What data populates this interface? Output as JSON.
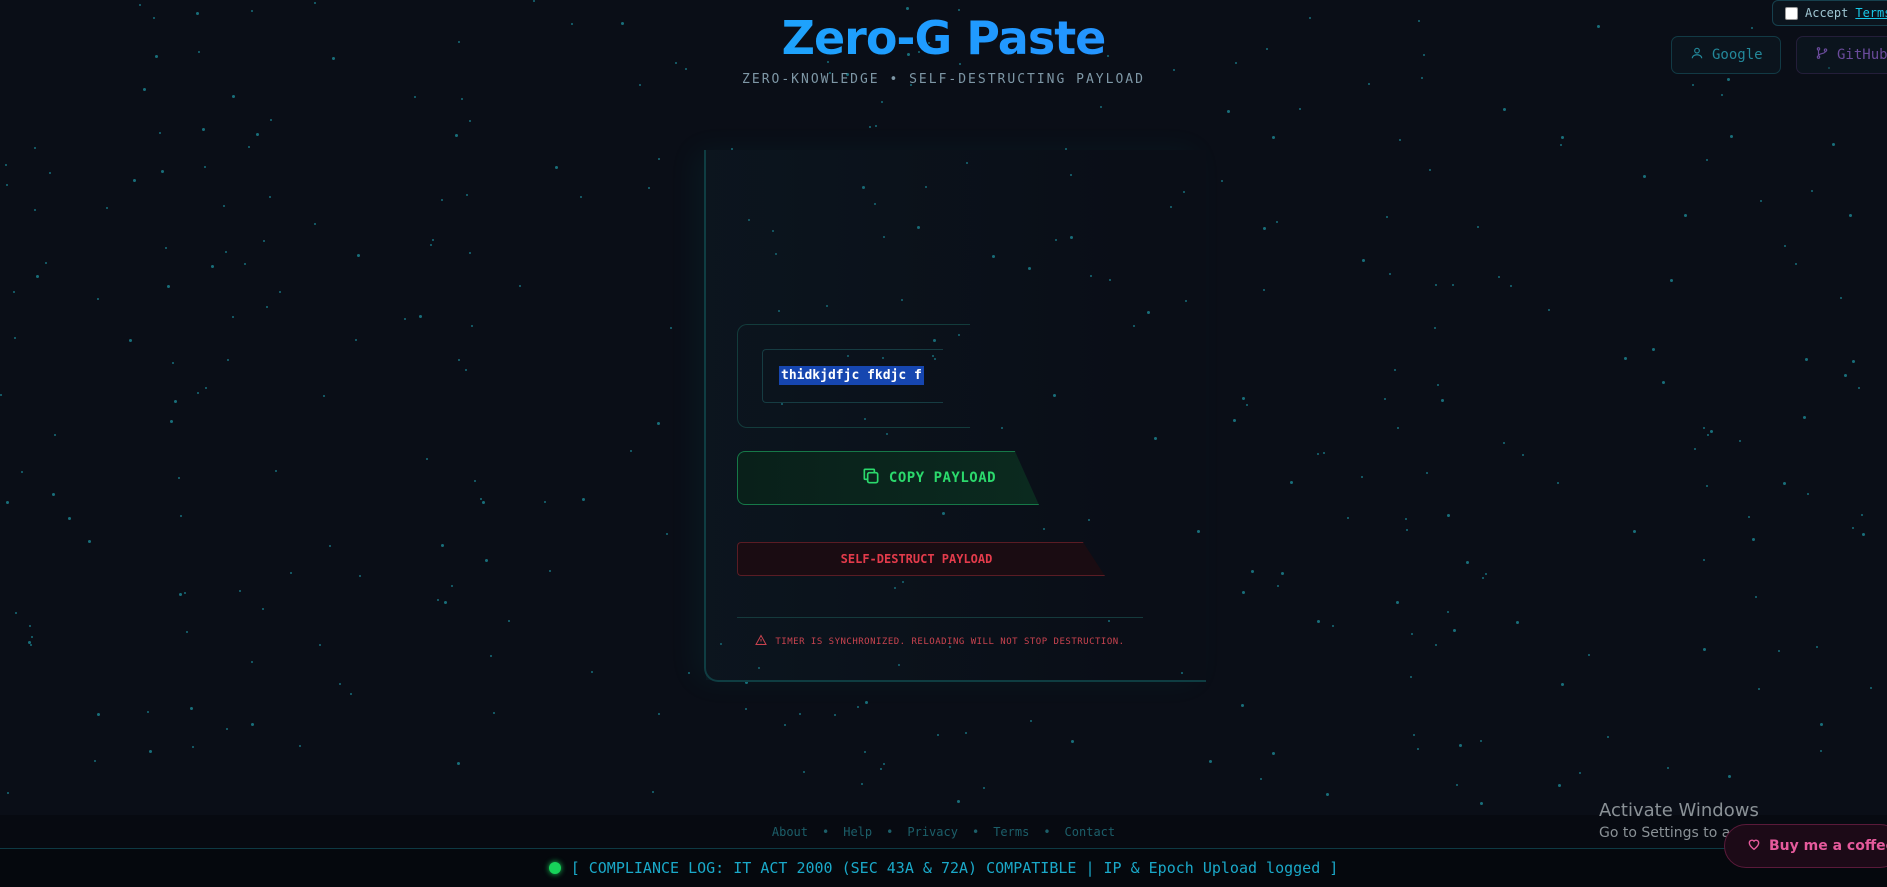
{
  "header": {
    "title": "Zero-G Paste",
    "subtitle": "ZERO-KNOWLEDGE • SELF-DESTRUCTING PAYLOAD"
  },
  "top_right": {
    "accept_label": "Accept",
    "terms_link": "Terms",
    "google_label": "Google",
    "github_label": "GitHub"
  },
  "payload": {
    "text": "thidkjdfjc fkdjc f"
  },
  "actions": {
    "copy_label": "COPY PAYLOAD",
    "destruct_label": "SELF-DESTRUCT PAYLOAD"
  },
  "warning": "TIMER IS SYNCHRONIZED. RELOADING WILL NOT STOP DESTRUCTION.",
  "footer": {
    "links": [
      "About",
      "Help",
      "Privacy",
      "Terms",
      "Contact"
    ],
    "compliance": "[ COMPLIANCE LOG: IT ACT 2000 (SEC 43A & 72A) COMPATIBLE | IP & Epoch Upload logged ]"
  },
  "os_overlay": {
    "activate_title": "Activate Windows",
    "activate_sub": "Go to Settings to activate Windows."
  },
  "coffee_label": "Buy me a coffee",
  "colors": {
    "background": "#0a0e17",
    "accent": "#1aa9c9",
    "copy_green": "#2bd96c",
    "danger_red": "#e33b4b",
    "status_green": "#17d35a"
  },
  "icons": [
    "user-icon",
    "git-branch-icon",
    "copy-icon",
    "warning-icon",
    "heart-icon",
    "status-dot-icon"
  ]
}
